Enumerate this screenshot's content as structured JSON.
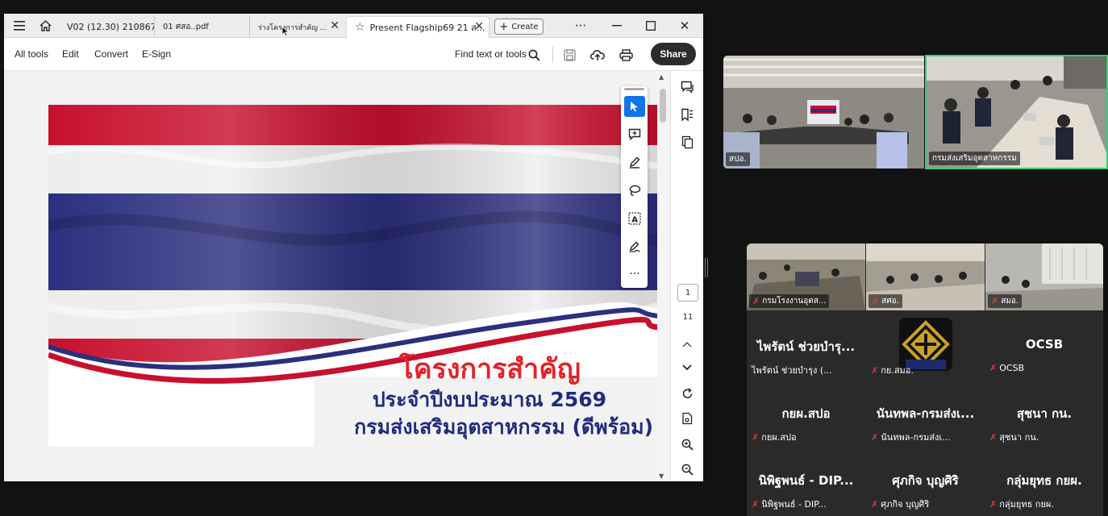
{
  "acrobat": {
    "tabs": [
      {
        "label": "V02 (12.30) 210867..."
      },
      {
        "label": "01 ศสอ..pdf"
      },
      {
        "label": "ร่างโครงการสำคัญ ..."
      },
      {
        "label": "Present Flagship69 21 ส..."
      }
    ],
    "create_label": "Create",
    "menu": [
      "All tools",
      "Edit",
      "Convert",
      "E-Sign"
    ],
    "find_label": "Find text or tools",
    "share_label": "Share",
    "page_current": "1",
    "page_total": "11",
    "slide": {
      "title": "โครงการสำคัญ",
      "subtitle1": "ประจำปีงบประมาณ 2569",
      "subtitle2": "กรมส่งเสริมอุตสาหกรรม (ดีพร้อม)"
    },
    "colors": {
      "flag_red": "#c8102e",
      "flag_blue": "#2b2f7e",
      "accent": "#1473e6"
    }
  },
  "meeting": {
    "videos": [
      {
        "name": "สปอ."
      },
      {
        "name": "กรมส่งเสริมอุตสาหกรรม"
      }
    ],
    "gallery_videos": [
      {
        "name": "กรมโรงงานอุตส..."
      },
      {
        "name": "สศอ."
      },
      {
        "name": "สมอ."
      }
    ],
    "participants": [
      {
        "display": "ไพรัตน์ ช่วยบำรุ...",
        "caption": "ไพรัตน์ ช่วยบำรุง (..."
      },
      {
        "display": "",
        "caption": "กย.สมอ."
      },
      {
        "display": "OCSB",
        "caption": "OCSB"
      },
      {
        "display": "กยผ.สปอ",
        "caption": "กยผ.สปอ"
      },
      {
        "display": "นันทพล-กรมส่งเ...",
        "caption": "นันทพล-กรมส่งเ..."
      },
      {
        "display": "สุชนา กน.",
        "caption": "สุชนา กน."
      },
      {
        "display": "นิพิฐพนธ์  - DIP...",
        "caption": "นิพิฐพนธ์  - DIP..."
      },
      {
        "display": "ศุภกิจ บุญศิริ",
        "caption": "ศุภกิจ บุญศิริ"
      },
      {
        "display": "กลุ่มยุทธ กยผ.",
        "caption": "กลุ่มยุทธ กยผ."
      }
    ],
    "muted_icon": "mic-off-icon",
    "active_speaker_color": "#2fd07a"
  }
}
